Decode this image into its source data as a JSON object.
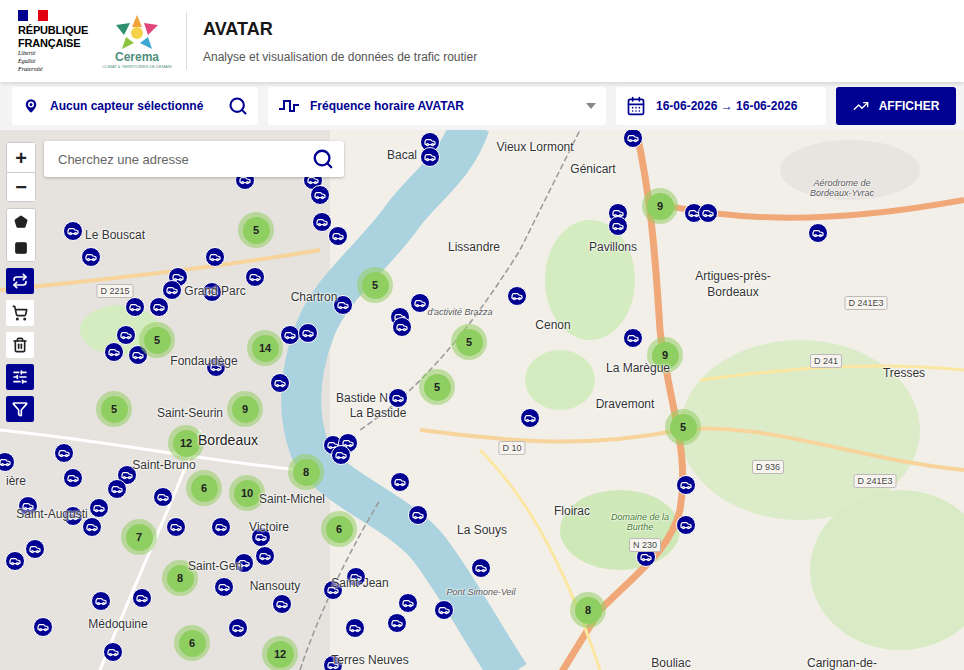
{
  "header": {
    "republic": [
      "RÉPUBLIQUE",
      "FRANÇAISE"
    ],
    "motto": [
      "Liberté",
      "Égalité",
      "Fraternité"
    ],
    "partner": "Cerema",
    "partner_tagline": "CLIMAT & TERRITOIRES DE DEMAIN",
    "title": "AVATAR",
    "subtitle": "Analyse et visualisation de données de trafic routier"
  },
  "toolbar": {
    "sensor": "Aucun capteur sélectionné",
    "frequency": "Fréquence horaire AVATAR",
    "dates": "16-06-2026 → 16-06-2026",
    "button": "AFFICHER"
  },
  "map": {
    "search_placeholder": "Cherchez une adresse",
    "zoom_in": "+",
    "zoom_out": "−",
    "tools": [
      {
        "kind": "polygon",
        "active": false
      },
      {
        "kind": "rectangle",
        "active": false
      },
      {
        "kind": "swap",
        "active": true
      },
      {
        "kind": "cart",
        "active": false
      },
      {
        "kind": "trash",
        "active": false
      },
      {
        "kind": "sliders",
        "active": true
      },
      {
        "kind": "filter",
        "active": true
      }
    ],
    "clusters": [
      {
        "count": "5"
      },
      {
        "count": "5"
      },
      {
        "count": "5"
      },
      {
        "count": "14"
      },
      {
        "count": "5"
      },
      {
        "count": "5"
      },
      {
        "count": "9"
      },
      {
        "count": "9"
      },
      {
        "count": "5"
      },
      {
        "count": "9"
      },
      {
        "count": "12"
      },
      {
        "count": "5"
      },
      {
        "count": "8"
      },
      {
        "count": "6"
      },
      {
        "count": "10"
      },
      {
        "count": "7"
      },
      {
        "count": "6"
      },
      {
        "count": "8"
      },
      {
        "count": "8"
      },
      {
        "count": "6"
      },
      {
        "count": "12"
      }
    ],
    "places": [
      {
        "text": "Bacal",
        "kind": "place"
      },
      {
        "text": "Vieux Lormont",
        "kind": "place"
      },
      {
        "text": "Génicart",
        "kind": "place"
      },
      {
        "text": "Aérodrome de Bordeaux-Yvrac",
        "kind": "poi"
      },
      {
        "text": "Le Bouscat",
        "kind": "place"
      },
      {
        "text": "Pavillons",
        "kind": "place"
      },
      {
        "text": "Lissandre",
        "kind": "place"
      },
      {
        "text": "Artigues-près-Bordeaux",
        "kind": "place"
      },
      {
        "text": "D 2215",
        "kind": "road"
      },
      {
        "text": "Grand Parc",
        "kind": "place"
      },
      {
        "text": "Chartron",
        "kind": "place"
      },
      {
        "text": "d'activité Brazza",
        "kind": "poi"
      },
      {
        "text": "D 241E3",
        "kind": "road"
      },
      {
        "text": "Cenon",
        "kind": "place"
      },
      {
        "text": "D 241",
        "kind": "road"
      },
      {
        "text": "Fondaudège",
        "kind": "place"
      },
      {
        "text": "La Marègue",
        "kind": "place"
      },
      {
        "text": "Tresses",
        "kind": "place"
      },
      {
        "text": "Bastide N",
        "kind": "place"
      },
      {
        "text": "La Bastide",
        "kind": "place"
      },
      {
        "text": "Dravemont",
        "kind": "place"
      },
      {
        "text": "Saint-Seurin",
        "kind": "place"
      },
      {
        "text": "Bordeaux",
        "kind": "city"
      },
      {
        "text": "D 10",
        "kind": "road"
      },
      {
        "text": "Saint-Bruno",
        "kind": "place"
      },
      {
        "text": "ière",
        "kind": "place"
      },
      {
        "text": "D 936",
        "kind": "road"
      },
      {
        "text": "D 241E3",
        "kind": "road"
      },
      {
        "text": "Saint-Michel",
        "kind": "place"
      },
      {
        "text": "Floirac",
        "kind": "place"
      },
      {
        "text": "Saint-Augusti",
        "kind": "place"
      },
      {
        "text": "Victoire",
        "kind": "place"
      },
      {
        "text": "La Souys",
        "kind": "place"
      },
      {
        "text": "Domaine de la Burthe",
        "kind": "park"
      },
      {
        "text": "N 230",
        "kind": "road"
      },
      {
        "text": "Saint-Gen",
        "kind": "place"
      },
      {
        "text": "Saint-Jean",
        "kind": "place"
      },
      {
        "text": "Pont Simone-Veil",
        "kind": "poi"
      },
      {
        "text": "Nansouty",
        "kind": "place"
      },
      {
        "text": "Médoquine",
        "kind": "place"
      },
      {
        "text": "Bouliac",
        "kind": "place"
      },
      {
        "text": "Carignan-de-",
        "kind": "place"
      },
      {
        "text": "Terres Neuves",
        "kind": "place"
      }
    ]
  }
}
